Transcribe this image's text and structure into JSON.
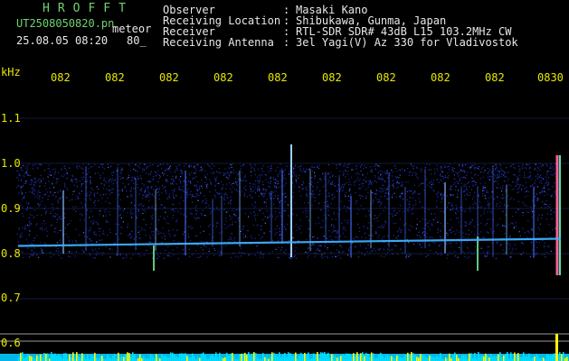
{
  "header": {
    "brand": "HROFFT",
    "file_name": "UT2508050820.pn",
    "class": "meteor",
    "date_time": "25.08.05 08:20",
    "level": "80_"
  },
  "meta": [
    {
      "label": "Observer",
      "value": "Masaki Kano"
    },
    {
      "label": "Receiving Location",
      "value": "Shibukawa, Gunma, Japan"
    },
    {
      "label": "Receiver",
      "value": "RTL-SDR SDR# 43dB L15 103.2MHz CW"
    },
    {
      "label": "Receiving Antenna",
      "value": "3el Yagi(V) Az 330 for Vladivostok"
    }
  ],
  "separator": ":",
  "chart_data": {
    "type": "heatmap",
    "title": "",
    "ylabel": "kHz",
    "x_ticks": [
      "082",
      "082",
      "082",
      "082",
      "082",
      "082",
      "082",
      "082",
      "082",
      "0830"
    ],
    "y_ticks": [
      "1.1",
      "1.0",
      "0.9",
      "0.8",
      "0.7",
      "0.6"
    ],
    "ylim": [
      0.58,
      1.14
    ],
    "band_khz": [
      0.79,
      1.0
    ],
    "carrier_khz": 0.825,
    "colors": {
      "background": "#000000",
      "noise": "#2a3fd0",
      "carrier": "#3fb0ff",
      "power": "#00e0ff",
      "power_peak": "#ffff00"
    }
  }
}
